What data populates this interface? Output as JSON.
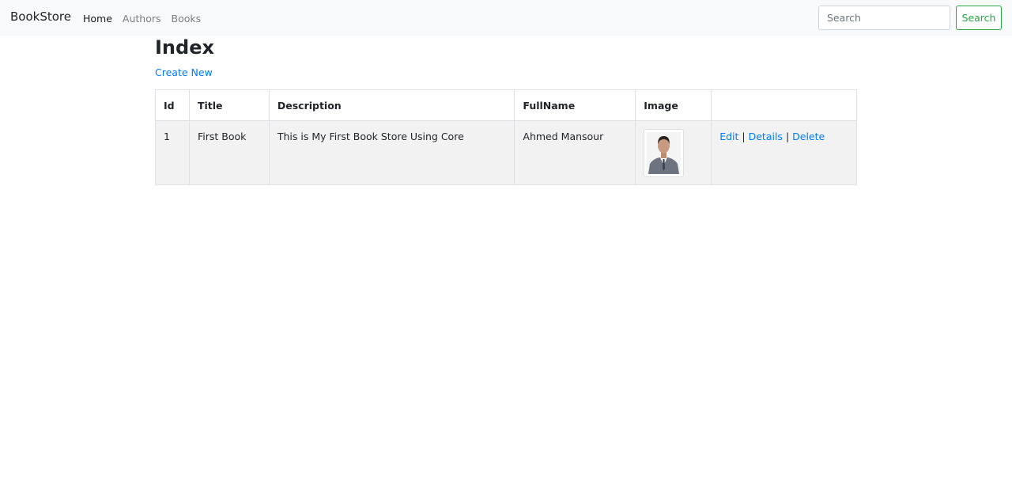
{
  "navbar": {
    "brand": "BookStore",
    "links": [
      "Home",
      "Authors",
      "Books"
    ],
    "search_placeholder": "Search",
    "search_button": "Search"
  },
  "page": {
    "title": "Index",
    "create_link": "Create New"
  },
  "table": {
    "headers": [
      "Id",
      "Title",
      "Description",
      "FullName",
      "Image",
      ""
    ],
    "rows": [
      {
        "id": "1",
        "title": "First Book",
        "description": "This is My First Book Store Using Core",
        "fullname": "Ahmed Mansour",
        "image_icon": "author-photo",
        "actions": [
          "Edit",
          "Details",
          "Delete"
        ],
        "separator": "|"
      }
    ]
  },
  "colors": {
    "navbar_bg": "#f8f9fa",
    "link": "#007bff",
    "success": "#28a745",
    "row_bg": "#f2f2f2"
  }
}
